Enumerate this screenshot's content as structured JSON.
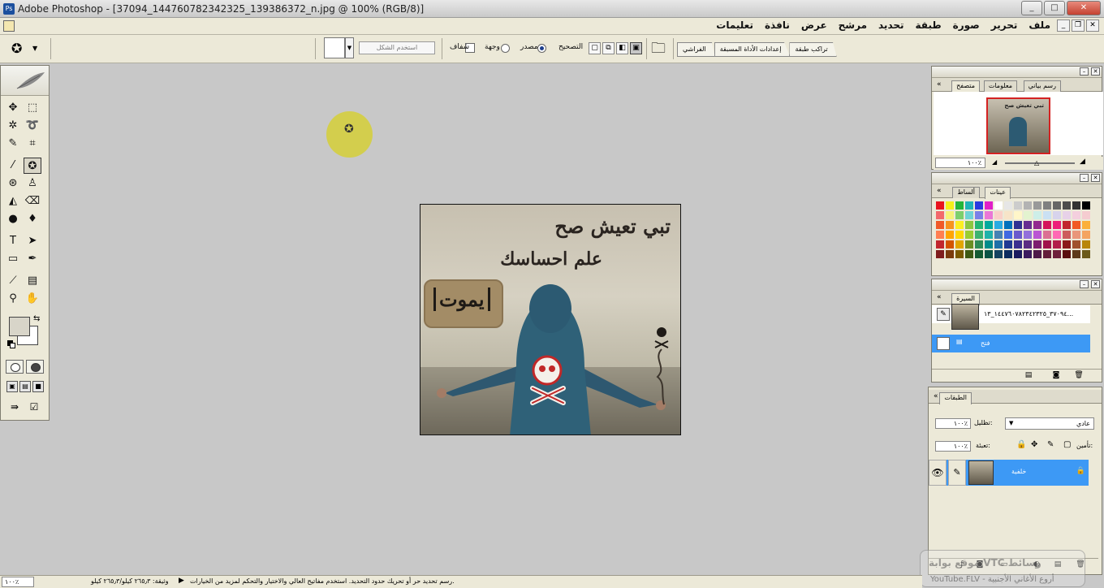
{
  "window": {
    "title": "Adobe Photoshop - [37094_144760782342325_139386372_n.jpg @ 100% (RGB/8)]",
    "app_icon": "Ps",
    "controls": [
      "_",
      "□",
      "✕"
    ]
  },
  "menu": {
    "items": [
      "ملف",
      "تحرير",
      "صورة",
      "طبقة",
      "تحديد",
      "مرشح",
      "عرض",
      "نافذة",
      "تعليمات"
    ],
    "doc_controls": [
      "_",
      "❐",
      "✕"
    ]
  },
  "options": {
    "pattern_label": "استخدم الشكل",
    "transparent_label": "شفاف",
    "destination_label": "وجهة",
    "source_label": "مصدر",
    "correct_label": "التصحيح",
    "well_tabs": [
      "تراكب طبقة",
      "إعدادات الأداة المسبقة",
      "الفراشي"
    ]
  },
  "canvas": {
    "line1": "تبي تعيش صح",
    "line2": "علم احساسك",
    "badge": "يموت"
  },
  "navigator": {
    "tabs": [
      "متصفح",
      "معلومات",
      "رسم بياني"
    ],
    "zoom": "١٠٠٪",
    "thumb_text": "تبي تعيش صح"
  },
  "swatches": {
    "tabs": [
      "عينات",
      "ألساط"
    ],
    "colors": [
      "#e8141e",
      "#f4ef1a",
      "#25b53a",
      "#1fb3b8",
      "#2a3ae0",
      "#e01ec8",
      "#ffffff",
      "#e6e6e6",
      "#cccccc",
      "#b3b3b3",
      "#999999",
      "#808080",
      "#666666",
      "#4d4d4d",
      "#333333",
      "#000000",
      "#f2696b",
      "#f6f27a",
      "#7ccf6d",
      "#6fd3d6",
      "#7b80e8",
      "#ea77d7",
      "#f9d0c9",
      "#f7e4c8",
      "#fff6c9",
      "#e3f3cf",
      "#cdeee8",
      "#cae0f3",
      "#d7d3ec",
      "#e7d1e8",
      "#f4cfde",
      "#f5ccd0",
      "#f05a28",
      "#f7931e",
      "#fcee21",
      "#8cc63f",
      "#22b573",
      "#00a99d",
      "#29abe2",
      "#0071bc",
      "#2e3192",
      "#662d91",
      "#93278f",
      "#d4145a",
      "#ed1e79",
      "#c1272d",
      "#f15a24",
      "#fbb03b",
      "#ff7f50",
      "#ffa500",
      "#ffd700",
      "#9acd32",
      "#3cb371",
      "#20b2aa",
      "#4682b4",
      "#4169e1",
      "#6a5acd",
      "#9370db",
      "#ba55d3",
      "#db7093",
      "#ff69b4",
      "#cd5c5c",
      "#e9967a",
      "#f4a460",
      "#c1272d",
      "#d35400",
      "#e1a500",
      "#6b8e23",
      "#2e8b57",
      "#008b8b",
      "#1e6fa8",
      "#1f3a93",
      "#3b2f8f",
      "#5b2c83",
      "#7d1e6f",
      "#a0124b",
      "#b21e4a",
      "#8b1a1a",
      "#a0522d",
      "#b8860b",
      "#7f1d1d",
      "#7a3b0c",
      "#7a5a00",
      "#3d5a14",
      "#145a32",
      "#0b5345",
      "#154360",
      "#0c2c5e",
      "#1b1b5e",
      "#3b1b5e",
      "#4e1a49",
      "#641e3a",
      "#6e1e3a",
      "#5b0f0f",
      "#5e3a1a",
      "#6b5a1a"
    ]
  },
  "history": {
    "tab": "السيرة",
    "snapshot_label": "٣٧٠٩٤_١٤٤٧٦٠٧٨٢٣٤٢٣٢٥_١٣...",
    "open_label": "فتح"
  },
  "layers": {
    "tab": "الطبقات",
    "blend_mode": "عادي",
    "opacity_label": "تظليل:",
    "opacity": "١٠٠٪",
    "lock_label": "تأمين:",
    "fill_label": "تعبئة:",
    "fill": "١٠٠٪",
    "layer_name": "خلفية"
  },
  "watermark": {
    "line1": "موقع بوابة VTC وسائط",
    "line2": "YouTube.FLV - أروع الأغاني الأجنبية"
  },
  "status": {
    "zoom": "١٠٠٪",
    "doc": "وثيقة: ٢٦٥٫٣ كيلو/٢٦٥٫٣ كيلو",
    "hint": "رسم تحديد حر أو تحريك حدود التحديد. استخدم مفاتيح العالي والاختيار والتحكم لمزيد من الخيارات."
  }
}
